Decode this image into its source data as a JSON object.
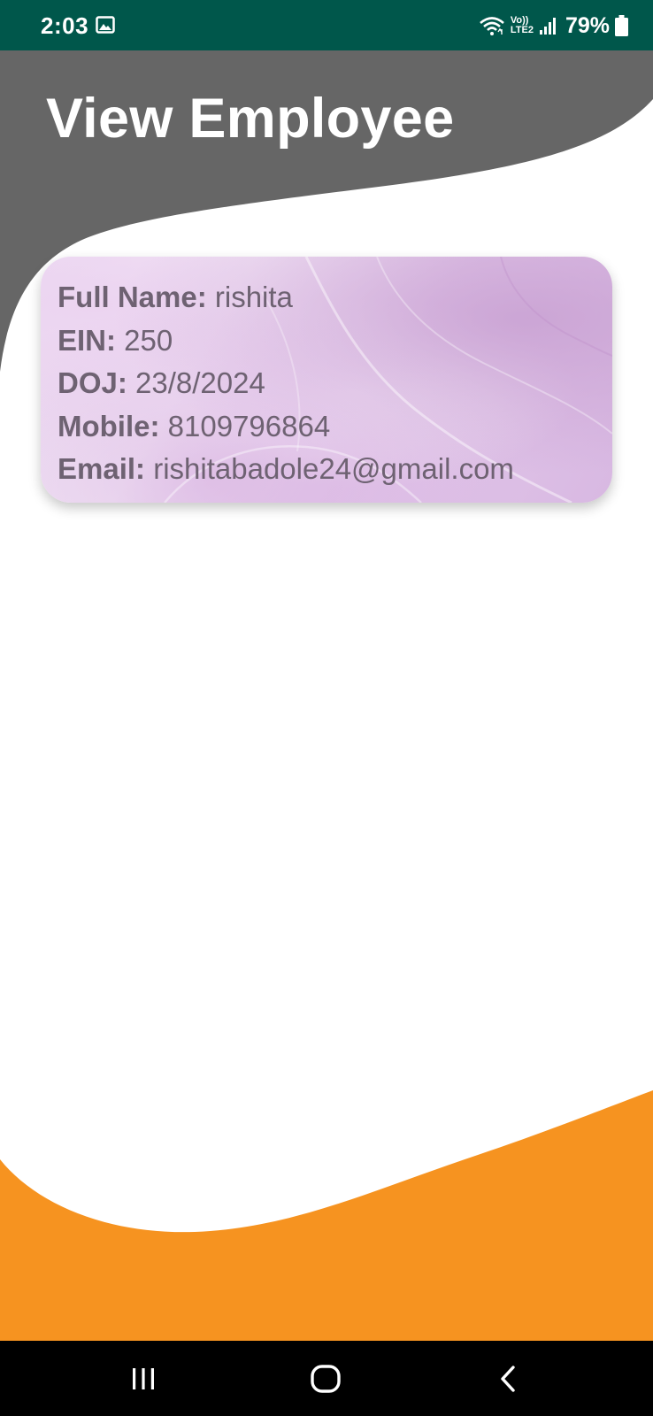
{
  "status_bar": {
    "time": "2:03",
    "volte_top": "Vo))",
    "volte_bottom": "LTE2",
    "battery": "79%",
    "icons": [
      "gallery-icon",
      "wifi-icon",
      "volte-icon",
      "signal-icon",
      "battery-icon"
    ]
  },
  "header": {
    "title": "View Employee"
  },
  "employee": {
    "full_name_label": "Full Name:",
    "full_name": "rishita",
    "ein_label": "EIN:",
    "ein": "250",
    "doj_label": "DOJ:",
    "doj": "23/8/2024",
    "mobile_label": "Mobile:",
    "mobile": "8109796864",
    "email_label": "Email:",
    "email": "rishitabadole24@gmail.com"
  },
  "nav_bar": {
    "buttons": [
      "recent-apps-icon",
      "home-icon",
      "back-icon"
    ]
  },
  "colors": {
    "status_bar": "#00574b",
    "header_wave": "#666666",
    "footer_wave": "#f69320",
    "card_text": "#6e6272",
    "nav_bar": "#000000"
  }
}
